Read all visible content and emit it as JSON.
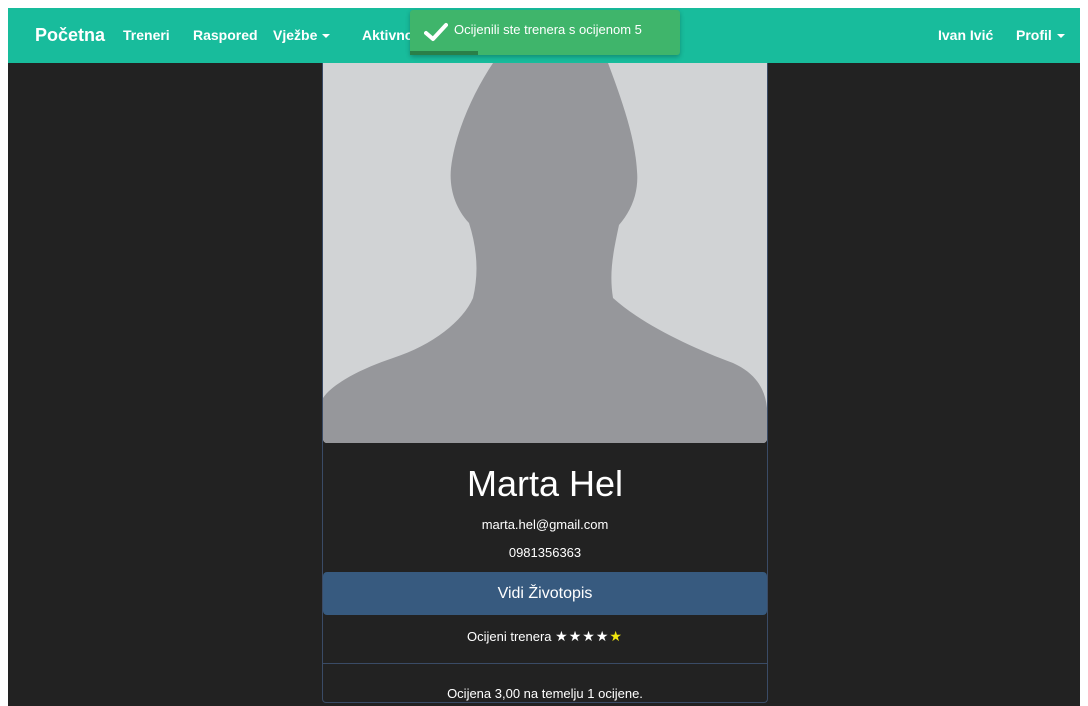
{
  "navbar": {
    "brand": "Početna",
    "items": [
      {
        "label": "Treneri"
      },
      {
        "label": "Raspored"
      },
      {
        "label": "Vježbe"
      },
      {
        "label": "Aktivnost"
      }
    ],
    "user": "Ivan Ivić",
    "profile": "Profil"
  },
  "toast": {
    "icon": "check-icon",
    "message": "Ocijenili ste trenera s ocijenom 5",
    "progress": 0.25
  },
  "trainer": {
    "name": "Marta Hel",
    "email": "marta.hel@gmail.com",
    "phone": "0981356363",
    "cv_button": "Vidi Životopis",
    "rate_label": "Ocijeni trenera",
    "stars": [
      {
        "glyph": "★",
        "active": false
      },
      {
        "glyph": "★",
        "active": false
      },
      {
        "glyph": "★",
        "active": false
      },
      {
        "glyph": "★",
        "active": false
      },
      {
        "glyph": "★",
        "active": true
      }
    ],
    "rating_summary": "Ocijena 3,00 na temelju 1 ocijene."
  },
  "colors": {
    "navbar": "#18bc9c",
    "background": "#222222",
    "toast": "#3fb56b",
    "button": "#375a7f",
    "star_active": "#f1e60f"
  }
}
